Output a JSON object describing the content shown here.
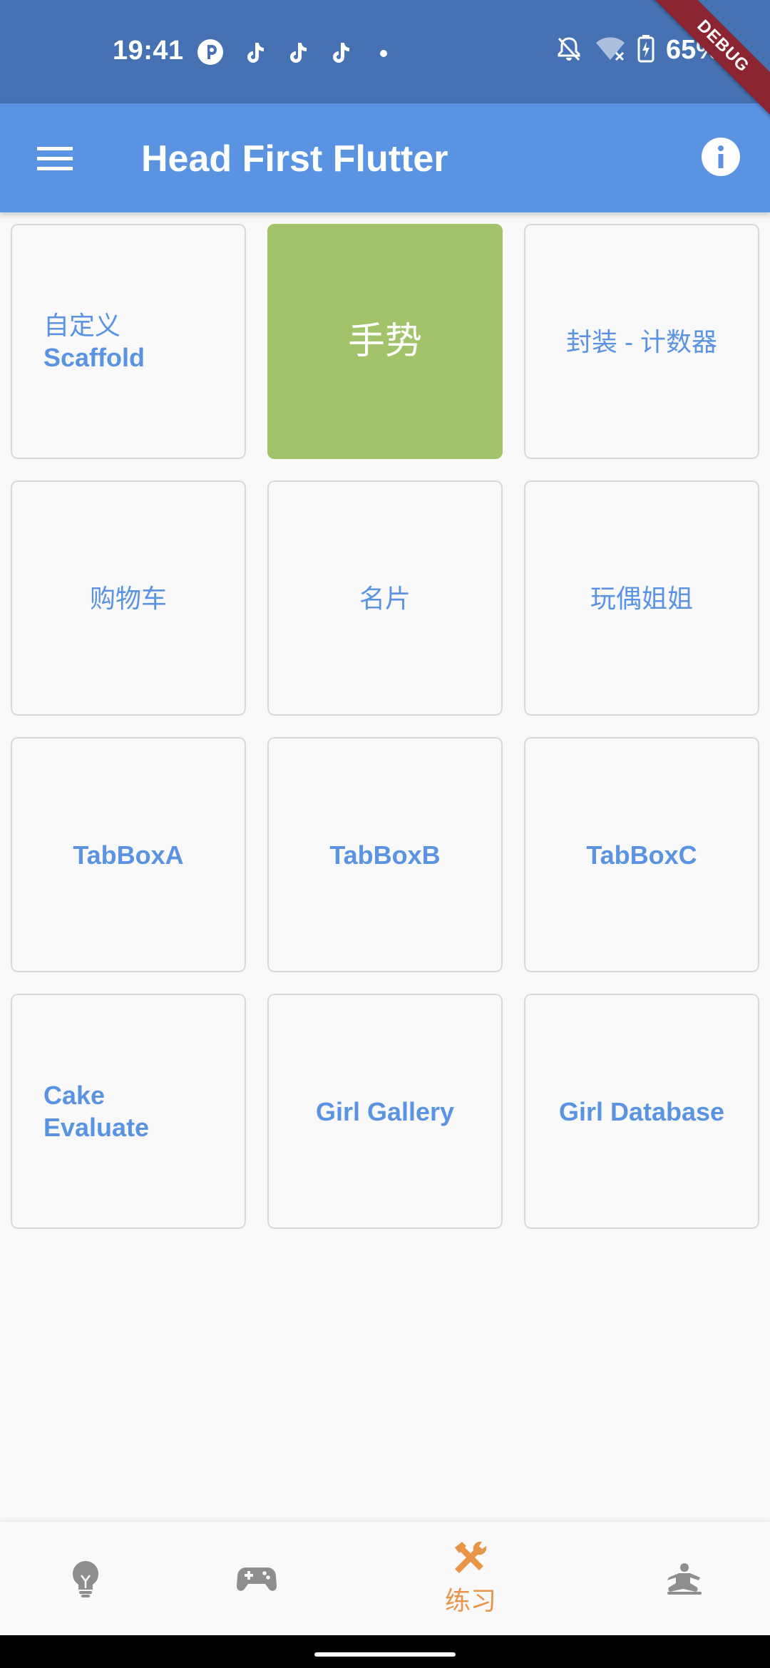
{
  "status_bar": {
    "time": "19:41",
    "battery": "65%",
    "background": "#4672b3"
  },
  "debug_banner": "DEBUG",
  "app_bar": {
    "title": "Head First Flutter",
    "background": "#5b93e3",
    "menu_icon": "hamburger-menu-icon",
    "info_icon": "info-icon"
  },
  "grid": {
    "tiles": [
      {
        "line1": "自定义",
        "line2": "Scaffold"
      },
      {
        "label": "手势"
      },
      {
        "label": "封装 - 计数器"
      },
      {
        "label": "购物车"
      },
      {
        "label": "名片"
      },
      {
        "label": "玩偶姐姐"
      },
      {
        "label": "TabBoxA"
      },
      {
        "label": "TabBoxB"
      },
      {
        "label": "TabBoxC"
      },
      {
        "line1": "Cake",
        "line2": "Evaluate"
      },
      {
        "label": "Girl Gallery"
      },
      {
        "label": "Girl Database"
      }
    ],
    "accent": "#5b93e3",
    "active_color": "#a1c36a"
  },
  "bottom_nav": {
    "items": [
      {
        "icon": "lightbulb-icon"
      },
      {
        "icon": "gamepad-icon"
      },
      {
        "icon": "tools-icon",
        "label": "练习",
        "active": true
      },
      {
        "icon": "meditation-person-icon"
      }
    ],
    "active_color": "#e8954a",
    "inactive_color": "#8e8e8e"
  }
}
